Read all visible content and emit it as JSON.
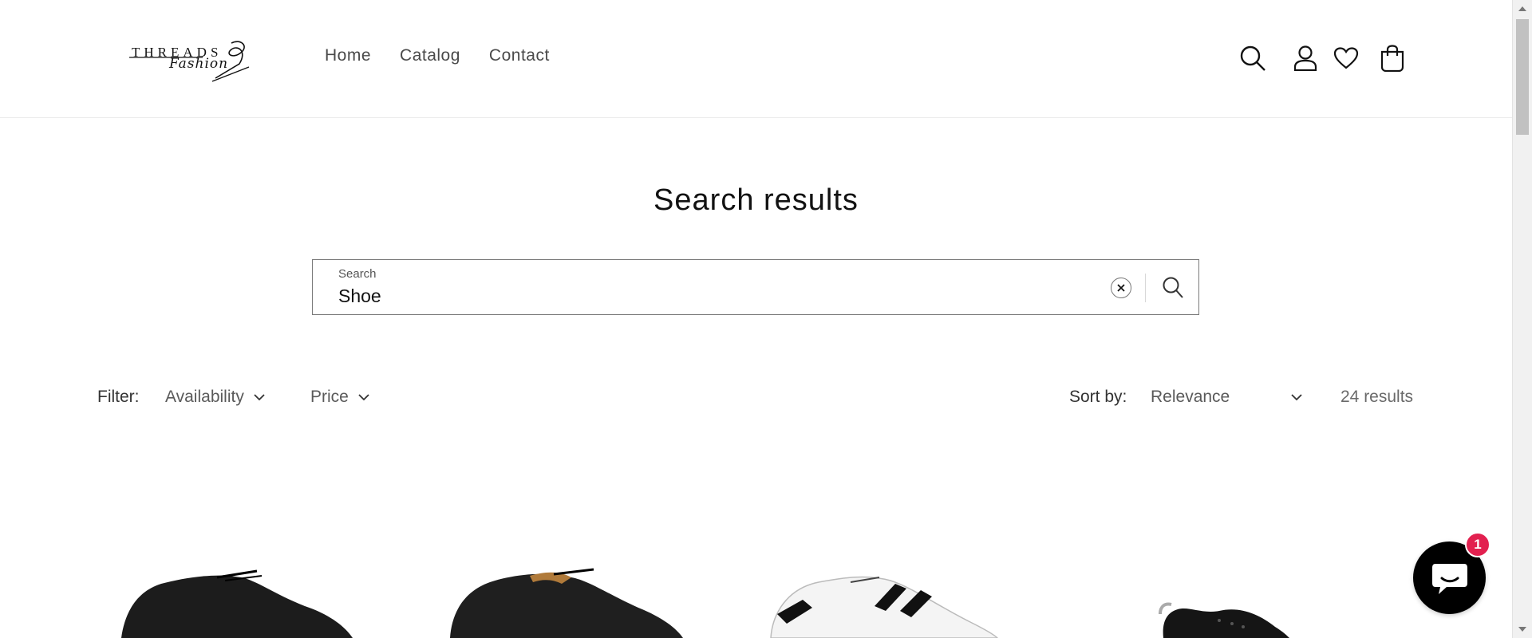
{
  "brand": {
    "name": "THREADS",
    "tagline": "Fashion"
  },
  "nav": {
    "items": [
      {
        "label": "Home"
      },
      {
        "label": "Catalog"
      },
      {
        "label": "Contact"
      }
    ]
  },
  "header_icons": [
    "search-icon",
    "account-icon",
    "heart-icon",
    "cart-icon"
  ],
  "page": {
    "title": "Search results"
  },
  "search": {
    "label": "Search",
    "value": "Shoe"
  },
  "filters": {
    "label": "Filter:",
    "options": [
      {
        "label": "Availability"
      },
      {
        "label": "Price"
      }
    ]
  },
  "sort": {
    "label": "Sort by:",
    "value": "Relevance"
  },
  "results": {
    "count": "24 results"
  },
  "chat": {
    "badge": "1"
  },
  "colors": {
    "accent_badge": "#e2204f",
    "chat_bg": "#000000",
    "text": "#121212"
  }
}
